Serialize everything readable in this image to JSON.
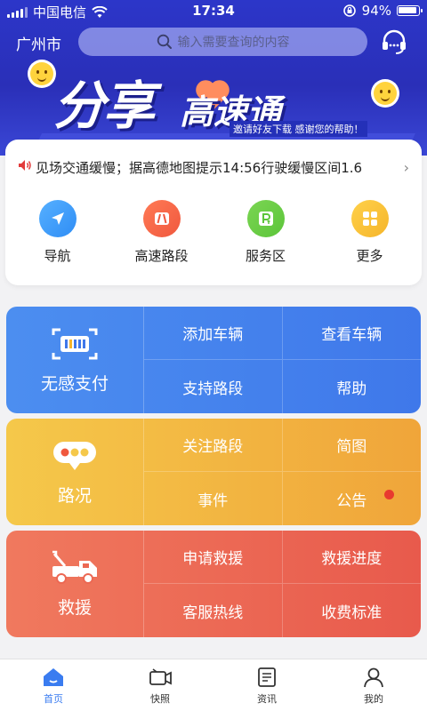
{
  "status_bar": {
    "carrier": "中国电信",
    "time": "17:34",
    "battery_percent": "94%"
  },
  "header": {
    "city": "广州市",
    "search_placeholder": "输入需要查询的内容",
    "customer_service_icon": "headset-icon"
  },
  "banner": {
    "title_big": "分享",
    "title_small": "高速通",
    "subtitle": "邀请好友下载  感谢您的帮助！"
  },
  "notice": {
    "icon": "speaker-icon",
    "text": "见场交通缓慢；据高德地图提示14:56行驶缓慢区间1.6"
  },
  "quick_actions": [
    {
      "label": "导航",
      "icon": "navigation-arrow-icon",
      "color": "#2f8df5"
    },
    {
      "label": "高速路段",
      "icon": "highway-icon",
      "color": "#f0583e"
    },
    {
      "label": "服务区",
      "icon": "service-area-icon",
      "color": "#5cc53a"
    },
    {
      "label": "更多",
      "icon": "more-grid-icon",
      "color": "#f5b52b"
    }
  ],
  "panels": [
    {
      "title": "无感支付",
      "icon": "etc-card-scan-icon",
      "color": "#4584ee",
      "items": [
        "添加车辆",
        "查看车辆",
        "支持路段",
        "帮助"
      ]
    },
    {
      "title": "路况",
      "icon": "traffic-light-icon",
      "color": "#f3b741",
      "items": [
        "关注路段",
        "简图",
        "事件",
        "公告"
      ],
      "badge_on": "公告"
    },
    {
      "title": "救援",
      "icon": "tow-truck-icon",
      "color": "#ec6853",
      "items": [
        "申请救援",
        "救援进度",
        "客服热线",
        "收费标准"
      ]
    }
  ],
  "tabbar": [
    {
      "label": "首页",
      "icon": "home-icon",
      "active": true
    },
    {
      "label": "快照",
      "icon": "camera-video-icon",
      "active": false
    },
    {
      "label": "资讯",
      "icon": "news-icon",
      "active": false
    },
    {
      "label": "我的",
      "icon": "user-icon",
      "active": false
    }
  ],
  "colors": {
    "header_bg": "#2c36c9",
    "active_tab": "#3a7cf0",
    "notice_icon": "#e23b3b",
    "badge": "#e83a2f"
  }
}
